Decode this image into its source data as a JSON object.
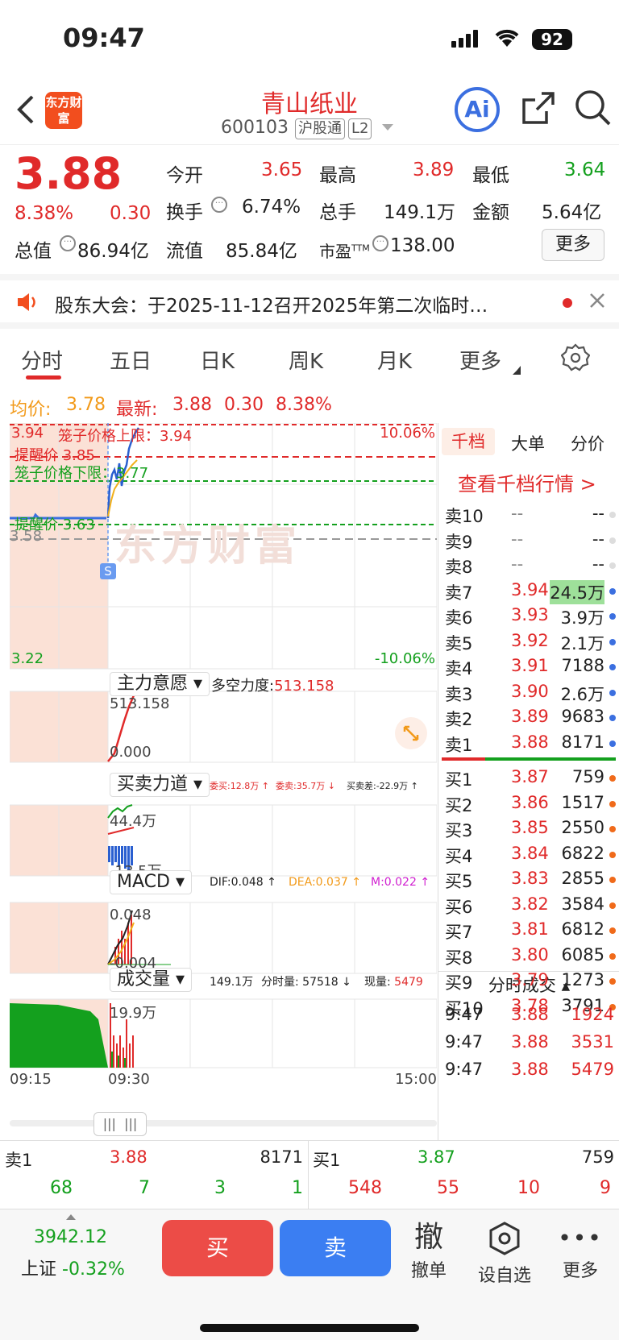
{
  "status": {
    "time": "09:47",
    "battery": "92"
  },
  "header": {
    "logo": "东方财富",
    "stock_name": "青山纸业",
    "code": "600103",
    "tag1": "沪股通",
    "tag2": "L2"
  },
  "quote": {
    "price": "3.88",
    "pct": "8.38%",
    "change": "0.30",
    "open_label": "今开",
    "open": "3.65",
    "high_label": "最高",
    "high": "3.89",
    "low_label": "最低",
    "low": "3.64",
    "turnover_label": "换手",
    "turnover": "6.74%",
    "volume_label": "总手",
    "volume": "149.1万",
    "amount_label": "金额",
    "amount": "5.64亿",
    "total_label": "总值",
    "total": "86.94亿",
    "float_label": "流值",
    "float": "85.84亿",
    "pe_label": "市盈",
    "pe_sup": "TTM",
    "pe": "138.00",
    "more": "更多"
  },
  "notice": {
    "text": "股东大会：于2025-11-12召开2025年第二次临时…"
  },
  "tabs": [
    "分时",
    "五日",
    "日K",
    "周K",
    "月K",
    "更多"
  ],
  "info": {
    "avg_label": "均价:",
    "avg": "3.78",
    "latest_label": "最新:",
    "latest": "3.88",
    "chg": "0.30",
    "pct": "8.38%"
  },
  "main_chart": {
    "max_price": "3.94",
    "min_price": "3.22",
    "upper_pct": "10.06%",
    "lower_pct": "-10.06%",
    "ref_price": "3.58",
    "cage_upper": "笼子价格上限：3.94",
    "alert_high": "提醒价 3.85",
    "cage_lower": "笼子价格下限：3.77",
    "alert_low": "提醒价 3.63",
    "marker": "S",
    "watermark": "东方财富",
    "time_start": "09:15",
    "time_mid": "09:30",
    "time_end": "15:00"
  },
  "sub1": {
    "selector": "主力意愿",
    "label": "多空力度:",
    "value": "513.158",
    "top": "513.158",
    "bottom": "0.000"
  },
  "sub2": {
    "selector": "买卖力道",
    "wm": "委买:12.8万 ↑",
    "ws": "委卖:35.7万 ↓",
    "diff": "买卖差:-22.9万 ↑",
    "top": "44.4万",
    "bottom": "-13.5万"
  },
  "sub3": {
    "selector": "MACD",
    "dif": "DIF:0.048 ↑",
    "dea": "DEA:0.037 ↑",
    "m": "M:0.022 ↑",
    "top": "0.048",
    "bottom": "-0.004"
  },
  "sub4": {
    "selector": "成交量",
    "total": "149.1万",
    "minute": "分时量: 57518 ↓",
    "now_label": "现量:",
    "now": "5479",
    "top": "19.9万"
  },
  "side": {
    "tabs": [
      "千档",
      "大单",
      "分价"
    ],
    "link": "查看千档行情 >",
    "sells": [
      {
        "l": "卖10",
        "p": "--",
        "v": "--"
      },
      {
        "l": "卖9",
        "p": "--",
        "v": "--"
      },
      {
        "l": "卖8",
        "p": "--",
        "v": "--"
      },
      {
        "l": "卖7",
        "p": "3.94",
        "v": "24.5万"
      },
      {
        "l": "卖6",
        "p": "3.93",
        "v": "3.9万"
      },
      {
        "l": "卖5",
        "p": "3.92",
        "v": "2.1万"
      },
      {
        "l": "卖4",
        "p": "3.91",
        "v": "7188"
      },
      {
        "l": "卖3",
        "p": "3.90",
        "v": "2.6万"
      },
      {
        "l": "卖2",
        "p": "3.89",
        "v": "9683"
      },
      {
        "l": "卖1",
        "p": "3.88",
        "v": "8171"
      }
    ],
    "buys": [
      {
        "l": "买1",
        "p": "3.87",
        "v": "759"
      },
      {
        "l": "买2",
        "p": "3.86",
        "v": "1517"
      },
      {
        "l": "买3",
        "p": "3.85",
        "v": "2550"
      },
      {
        "l": "买4",
        "p": "3.84",
        "v": "6822"
      },
      {
        "l": "买5",
        "p": "3.83",
        "v": "2855"
      },
      {
        "l": "买6",
        "p": "3.82",
        "v": "3584"
      },
      {
        "l": "买7",
        "p": "3.81",
        "v": "6812"
      },
      {
        "l": "买8",
        "p": "3.80",
        "v": "6085"
      },
      {
        "l": "买9",
        "p": "3.79",
        "v": "1273"
      },
      {
        "l": "买10",
        "p": "3.78",
        "v": "3791"
      }
    ],
    "trades_title": "分时成交",
    "trades": [
      {
        "t": "9:47",
        "p": "3.88",
        "v": "1924"
      },
      {
        "t": "9:47",
        "p": "3.88",
        "v": "3531"
      },
      {
        "t": "9:47",
        "p": "3.88",
        "v": "5479"
      }
    ]
  },
  "bottom_quote": {
    "sell_label": "卖1",
    "sell_price": "3.88",
    "sell_vol": "8171",
    "buy_label": "买1",
    "buy_price": "3.87",
    "buy_vol": "759",
    "sell_queue": [
      "68",
      "7",
      "3",
      "1"
    ],
    "buy_queue": [
      "548",
      "55",
      "10",
      "9"
    ]
  },
  "toolbar": {
    "index_value": "3942.12",
    "index_name": "上证",
    "index_pct": "-0.32%",
    "buy": "买",
    "sell": "卖",
    "cancel_icon": "撤",
    "cancel": "撤单",
    "watch": "设自选",
    "more": "更多"
  }
}
